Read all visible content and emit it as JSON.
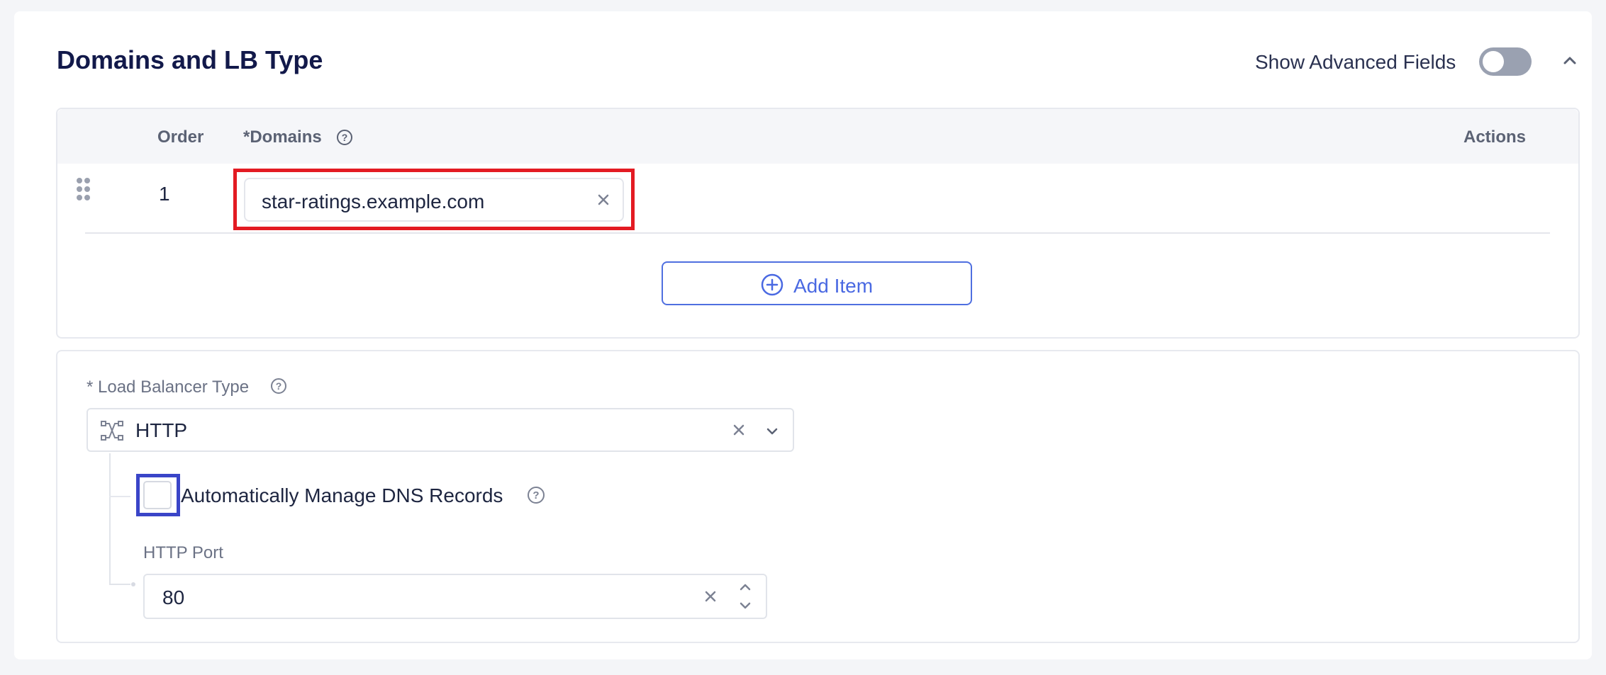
{
  "section": {
    "title": "Domains and LB Type",
    "show_advanced_label": "Show Advanced Fields",
    "show_advanced_enabled": false
  },
  "domains_table": {
    "columns": {
      "order": "Order",
      "domains": "*Domains",
      "actions": "Actions"
    },
    "rows": [
      {
        "order": "1",
        "domain": "star-ratings.example.com"
      }
    ],
    "add_item_label": "Add Item"
  },
  "lb_type": {
    "label": "* Load Balancer Type",
    "value": "HTTP",
    "dns_checkbox_label": "Automatically Manage DNS Records",
    "dns_checked": false,
    "http_port_label": "HTTP Port",
    "http_port_value": "80"
  },
  "colors": {
    "accent": "#4a69e2",
    "highlight_red": "#e31b23",
    "highlight_blue": "#3a45c8",
    "title": "#12194a"
  }
}
